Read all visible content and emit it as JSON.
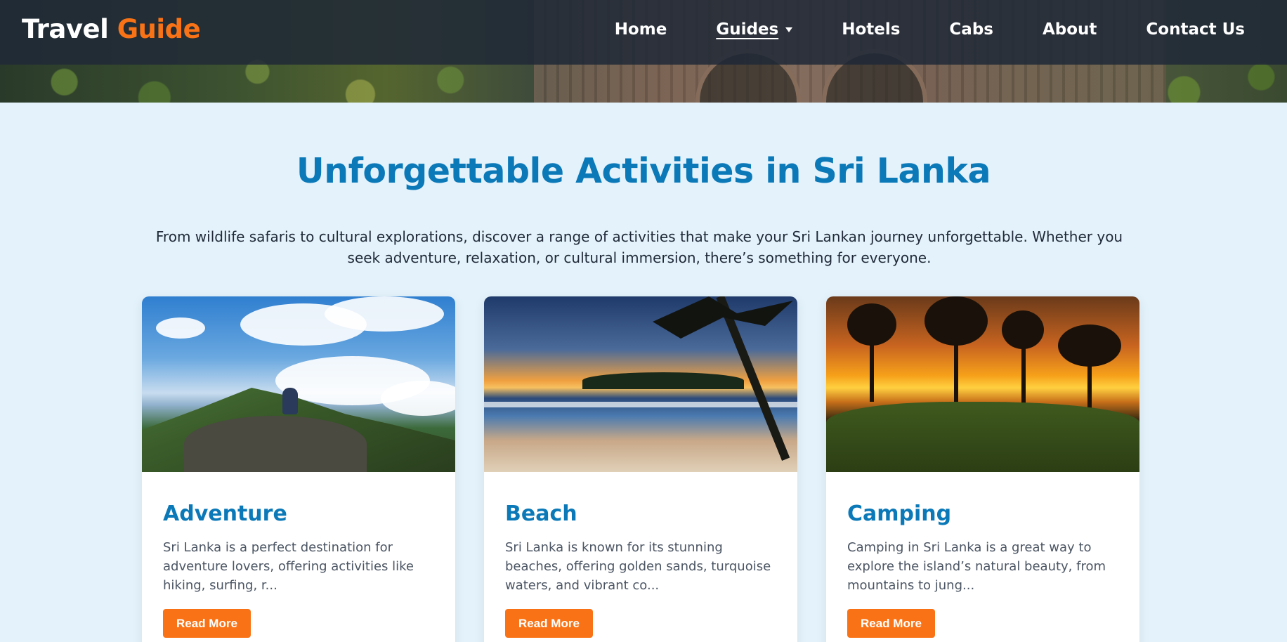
{
  "brand": {
    "part1": "Travel",
    "part2": "Guide",
    "accent_color": "#f97316",
    "primary_color": "#0b79b8"
  },
  "nav": {
    "items": [
      {
        "label": "Home"
      },
      {
        "label": "Guides",
        "active": true,
        "dropdown": true
      },
      {
        "label": "Hotels"
      },
      {
        "label": "Cabs"
      },
      {
        "label": "About"
      },
      {
        "label": "Contact Us"
      }
    ]
  },
  "main": {
    "title": "Unforgettable Activities in Sri Lanka",
    "intro": "From wildlife safaris to cultural explorations, discover a range of activities that make your Sri Lankan journey unforgettable. Whether you seek adventure, relaxation, or cultural immersion, there’s something for everyone."
  },
  "cards": [
    {
      "title": "Adventure",
      "text": "Sri Lanka is a perfect destination for adventure lovers, offering activities like hiking, surfing, r...",
      "button": "Read More",
      "image": "mountain-adventure-photo"
    },
    {
      "title": "Beach",
      "text": "Sri Lanka is known for its stunning beaches, offering golden sands, turquoise waters, and vibrant co...",
      "button": "Read More",
      "image": "beach-sunset-photo"
    },
    {
      "title": "Camping",
      "text": "Camping in Sri Lanka is a great way to explore the island’s natural beauty, from mountains to jung...",
      "button": "Read More",
      "image": "camping-sunset-photo"
    }
  ]
}
